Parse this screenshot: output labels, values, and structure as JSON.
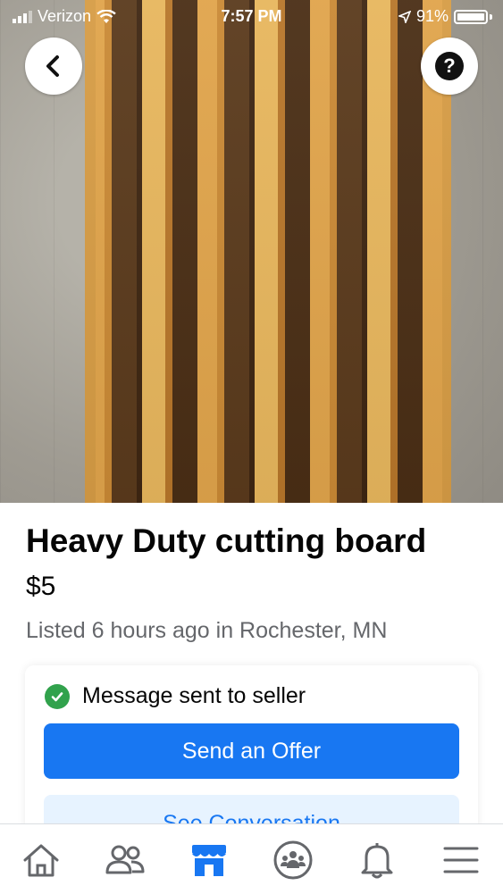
{
  "status_bar": {
    "carrier": "Verizon",
    "time": "7:57 PM",
    "battery": "91%",
    "icons": [
      "signal-bars-icon",
      "wifi-icon",
      "location-arrow-icon",
      "battery-icon"
    ]
  },
  "header": {
    "back_icon": "chevron-left-icon",
    "help_label": "?"
  },
  "listing": {
    "title": "Heavy Duty cutting board",
    "price": "$5",
    "listed": "Listed 6 hours ago in Rochester, MN"
  },
  "message_card": {
    "status": "Message sent to seller",
    "offer_label": "Send an Offer",
    "conversation_label": "See Conversation"
  },
  "tabbar": {
    "tabs": [
      "home-icon",
      "friends-icon",
      "marketplace-icon",
      "groups-icon",
      "notifications-bell-icon",
      "menu-icon"
    ],
    "active": "marketplace"
  },
  "colors": {
    "accent": "#1877f2",
    "accent_light": "#e7f3ff",
    "success": "#31a24c",
    "muted_text": "#65676b"
  }
}
